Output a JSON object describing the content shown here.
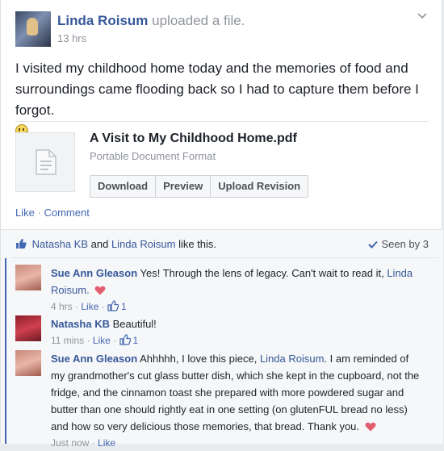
{
  "post": {
    "author": "Linda Roisum",
    "action": "uploaded a file.",
    "timestamp": "13 hrs",
    "text": "I visited my childhood home today and the memories of food and surroundings came flooding back so I had to capture them before I forgot.",
    "menu_icon": "chevron-down-icon"
  },
  "attachment": {
    "title": "A Visit to My Childhood Home.pdf",
    "type": "Portable Document Format",
    "buttons": {
      "download": "Download",
      "preview": "Preview",
      "upload_revision": "Upload Revision"
    }
  },
  "post_actions": {
    "like": "Like",
    "separator": "·",
    "comment": "Comment"
  },
  "likes": {
    "liker1": "Natasha KB",
    "connector": "and",
    "liker2": "Linda Roisum",
    "suffix": "like this.",
    "seen": "Seen by 3"
  },
  "comments": [
    {
      "author": "Sue Ann Gleason",
      "text": "Yes! Through the lens of legacy. Can't wait to read it,",
      "mention": "Linda Roisum.",
      "time": "4 hrs",
      "like_label": "Like",
      "like_count": "1"
    },
    {
      "author": "Natasha KB",
      "text": "Beautiful!",
      "time": "11 mins",
      "like_label": "Like",
      "like_count": "1"
    },
    {
      "author": "Sue Ann Gleason",
      "text_before": "Ahhhhh, I love this piece,",
      "mention": "Linda Roisum",
      "text_after": ". I am reminded of my grandmother's cut glass butter dish, which she kept in the cupboard, not the fridge, and the cinnamon toast she prepared with more powdered sugar and butter than one should rightly eat in one setting (on glutenFUL bread no less) and how so very delicious those memories, that bread. Thank you.",
      "time": "Just now",
      "like_label": "Like"
    }
  ],
  "colors": {
    "link": "#365899",
    "accent": "#4267b2",
    "muted": "#90949c",
    "heart": "#e25d6f"
  }
}
